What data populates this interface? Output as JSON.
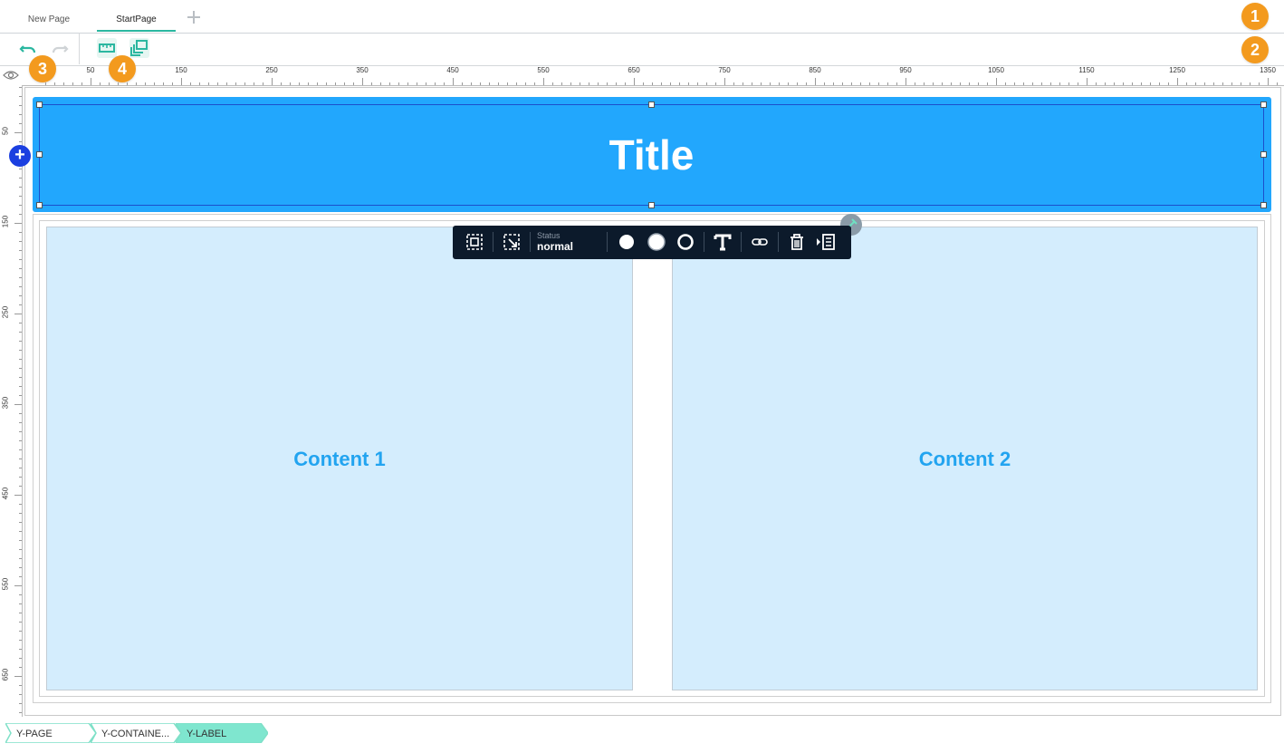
{
  "tabs": [
    {
      "label": "New Page"
    },
    {
      "label": "StartPage"
    }
  ],
  "badges": [
    "1",
    "2",
    "3",
    "4"
  ],
  "ruler": {
    "top_labels": [
      "50",
      "150",
      "250",
      "350",
      "450",
      "550",
      "650",
      "750",
      "850",
      "950",
      "1050",
      "1150",
      "1250",
      "1350"
    ],
    "left_labels": [
      "50",
      "150",
      "250",
      "350",
      "450",
      "550",
      "650"
    ]
  },
  "canvas": {
    "title": "Title",
    "content1": "Content 1",
    "content2": "Content 2"
  },
  "float_toolbar": {
    "status_label": "Status",
    "status_value": "normal"
  },
  "breadcrumb": [
    "Y-PAGE",
    "Y-CONTAINE...",
    "Y-LABEL"
  ],
  "colors": {
    "accent": "#2bb7a0",
    "title_bg": "#22a7fd",
    "content_bg": "#d4edfd",
    "badge": "#f39a1e",
    "selection": "#1c4fcc"
  }
}
